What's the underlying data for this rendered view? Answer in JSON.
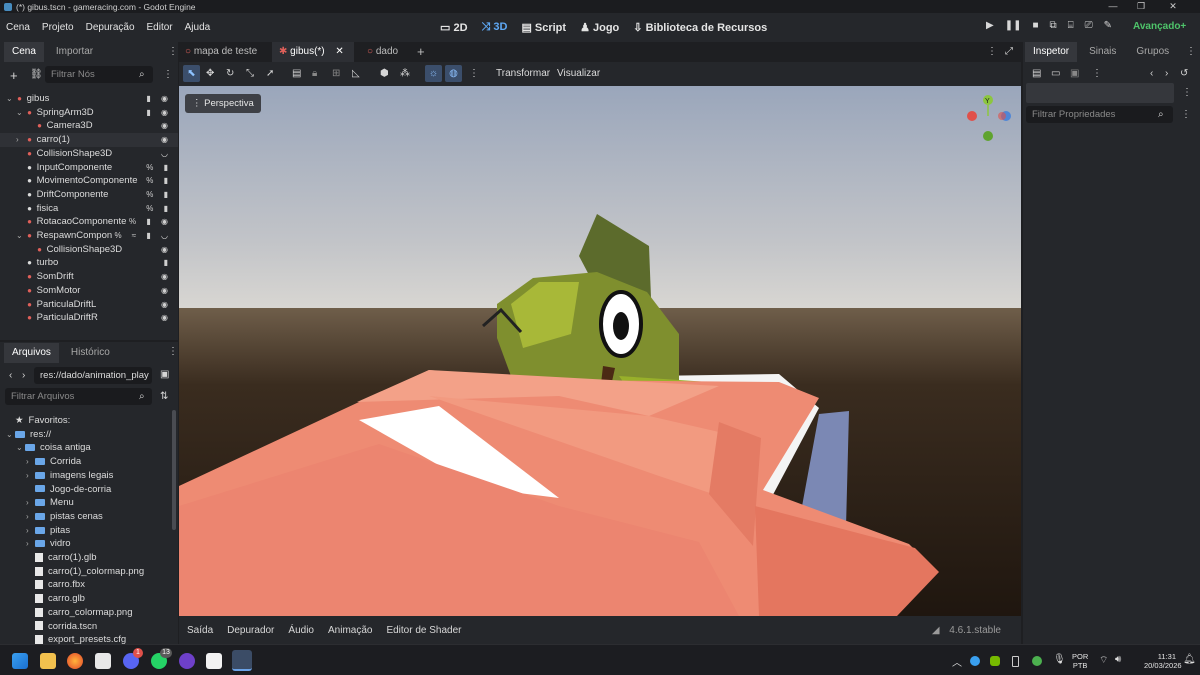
{
  "window": {
    "title": "(*) gibus.tscn - gameracing.com - Godot Engine"
  },
  "menu": [
    "Cena",
    "Projeto",
    "Depuração",
    "Editor",
    "Ajuda"
  ],
  "modes": [
    "2D",
    "3D",
    "Script",
    "Jogo",
    "Biblioteca de Recursos"
  ],
  "renderer": "Avançado+",
  "scene_dock": {
    "tabs": [
      "Cena",
      "Importar"
    ],
    "filter_placeholder": "Filtrar Nós",
    "nodes": [
      {
        "name": "gibus",
        "indent": 0,
        "arrow": "v",
        "color": "#e0605a",
        "icons": "▮ ◉"
      },
      {
        "name": "SpringArm3D",
        "indent": 1,
        "arrow": "v",
        "color": "#e0605a",
        "icons": "▮ ◉"
      },
      {
        "name": "Camera3D",
        "indent": 2,
        "arrow": "",
        "color": "#e0605a",
        "icons": "◉"
      },
      {
        "name": "carro(1)",
        "indent": 1,
        "arrow": ">",
        "color": "#e0605a",
        "icons": "◉"
      },
      {
        "name": "CollisionShape3D",
        "indent": 1,
        "arrow": "",
        "color": "#e0605a",
        "icons": "◡"
      },
      {
        "name": "InputComponente",
        "indent": 1,
        "arrow": "",
        "color": "#dcdcdc",
        "icons": "% ▮"
      },
      {
        "name": "MovimentoComponente",
        "indent": 1,
        "arrow": "",
        "color": "#dcdcdc",
        "icons": "% ▮"
      },
      {
        "name": "DriftComponente",
        "indent": 1,
        "arrow": "",
        "color": "#dcdcdc",
        "icons": "% ▮"
      },
      {
        "name": "fisica",
        "indent": 1,
        "arrow": "",
        "color": "#dcdcdc",
        "icons": "% ▮"
      },
      {
        "name": "RotacaoComponente",
        "indent": 1,
        "arrow": "",
        "color": "#e0605a",
        "icons": "% ▮ ◉"
      },
      {
        "name": "RespawnCompon",
        "indent": 1,
        "arrow": "v",
        "color": "#e0605a",
        "icons": "% ≈ ▮ ◡"
      },
      {
        "name": "CollisionShape3D",
        "indent": 2,
        "arrow": "",
        "color": "#e0605a",
        "icons": "◉"
      },
      {
        "name": "turbo",
        "indent": 1,
        "arrow": "",
        "color": "#dcdcdc",
        "icons": "▮"
      },
      {
        "name": "SomDrift",
        "indent": 1,
        "arrow": "",
        "color": "#e0605a",
        "icons": "◉"
      },
      {
        "name": "SomMotor",
        "indent": 1,
        "arrow": "",
        "color": "#e0605a",
        "icons": "◉"
      },
      {
        "name": "ParticulaDriftL",
        "indent": 1,
        "arrow": "",
        "color": "#e0605a",
        "icons": "◉"
      },
      {
        "name": "ParticulaDriftR",
        "indent": 1,
        "arrow": "",
        "color": "#e0605a",
        "icons": "◉"
      }
    ]
  },
  "files_dock": {
    "tabs": [
      "Arquivos",
      "Histórico"
    ],
    "path": "res://dado/animation_play",
    "filter_placeholder": "Filtrar Arquivos",
    "items": [
      {
        "name": "Favoritos:",
        "kind": "fav",
        "indent": 0
      },
      {
        "name": "res://",
        "kind": "folder",
        "indent": 0
      },
      {
        "name": "coisa antiga",
        "kind": "folder",
        "indent": 1
      },
      {
        "name": "Corrida",
        "kind": "folder",
        "indent": 2
      },
      {
        "name": "imagens legais",
        "kind": "folder",
        "indent": 2
      },
      {
        "name": "Jogo-de-corria",
        "kind": "folder",
        "indent": 2
      },
      {
        "name": "Menu",
        "kind": "folder",
        "indent": 2
      },
      {
        "name": "pistas cenas",
        "kind": "folder",
        "indent": 2
      },
      {
        "name": "pitas",
        "kind": "folder",
        "indent": 2
      },
      {
        "name": "vidro",
        "kind": "folder",
        "indent": 2
      },
      {
        "name": "carro(1).glb",
        "kind": "file",
        "indent": 2
      },
      {
        "name": "carro(1)_colormap.png",
        "kind": "file",
        "indent": 2
      },
      {
        "name": "carro.fbx",
        "kind": "file",
        "indent": 2
      },
      {
        "name": "carro.glb",
        "kind": "file",
        "indent": 2
      },
      {
        "name": "carro_colormap.png",
        "kind": "file",
        "indent": 2
      },
      {
        "name": "corrida.tscn",
        "kind": "file",
        "indent": 2
      },
      {
        "name": "export_presets.cfg",
        "kind": "file",
        "indent": 2
      }
    ]
  },
  "editor_tabs": [
    {
      "label": "mapa de teste",
      "active": false
    },
    {
      "label": "gibus(*)",
      "active": true
    },
    {
      "label": "dado",
      "active": false
    }
  ],
  "toolbar": {
    "transform": "Transformar",
    "view": "Visualizar"
  },
  "viewport": {
    "perspective_label": "Perspectiva",
    "gizmo_y": "Y"
  },
  "bottom_tabs": [
    "Saída",
    "Depurador",
    "Áudio",
    "Animação",
    "Editor de Shader"
  ],
  "version": "4.6.1.stable",
  "inspector": {
    "tabs": [
      "Inspetor",
      "Sinais",
      "Grupos"
    ],
    "filter_placeholder": "Filtrar Propriedades"
  },
  "taskbar": {
    "lang_top": "POR",
    "lang_bottom": "PTB",
    "time": "11:31",
    "date": "20/03/2026",
    "badge_discord": "1",
    "badge_whatsapp": "13"
  }
}
